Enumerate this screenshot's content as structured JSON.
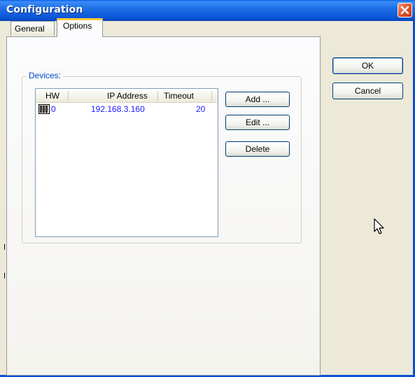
{
  "window": {
    "title": "Configuration"
  },
  "tabs": [
    {
      "label": "General",
      "active": false
    },
    {
      "label": "Options",
      "active": true
    }
  ],
  "devices": {
    "group_label": "Devices:",
    "columns": [
      "HW",
      "IP Address",
      "Timeout"
    ],
    "rows": [
      {
        "hw": "0",
        "ip": "192.168.3.160",
        "timeout": "20",
        "icon": "hardware-module-icon"
      }
    ]
  },
  "buttons": {
    "add": "Add ...",
    "edit": "Edit ...",
    "delete": "Delete",
    "ok": "OK",
    "cancel": "Cancel"
  },
  "colors": {
    "titlebar": "#0a55d8",
    "close": "#e35a33",
    "group_label": "#0046d5",
    "row_text": "#1a1aff",
    "tab_highlight": "#ffc83c"
  },
  "icons": {
    "close": "close-icon",
    "cursor": "mouse-pointer-icon",
    "device": "hardware-module-icon"
  }
}
